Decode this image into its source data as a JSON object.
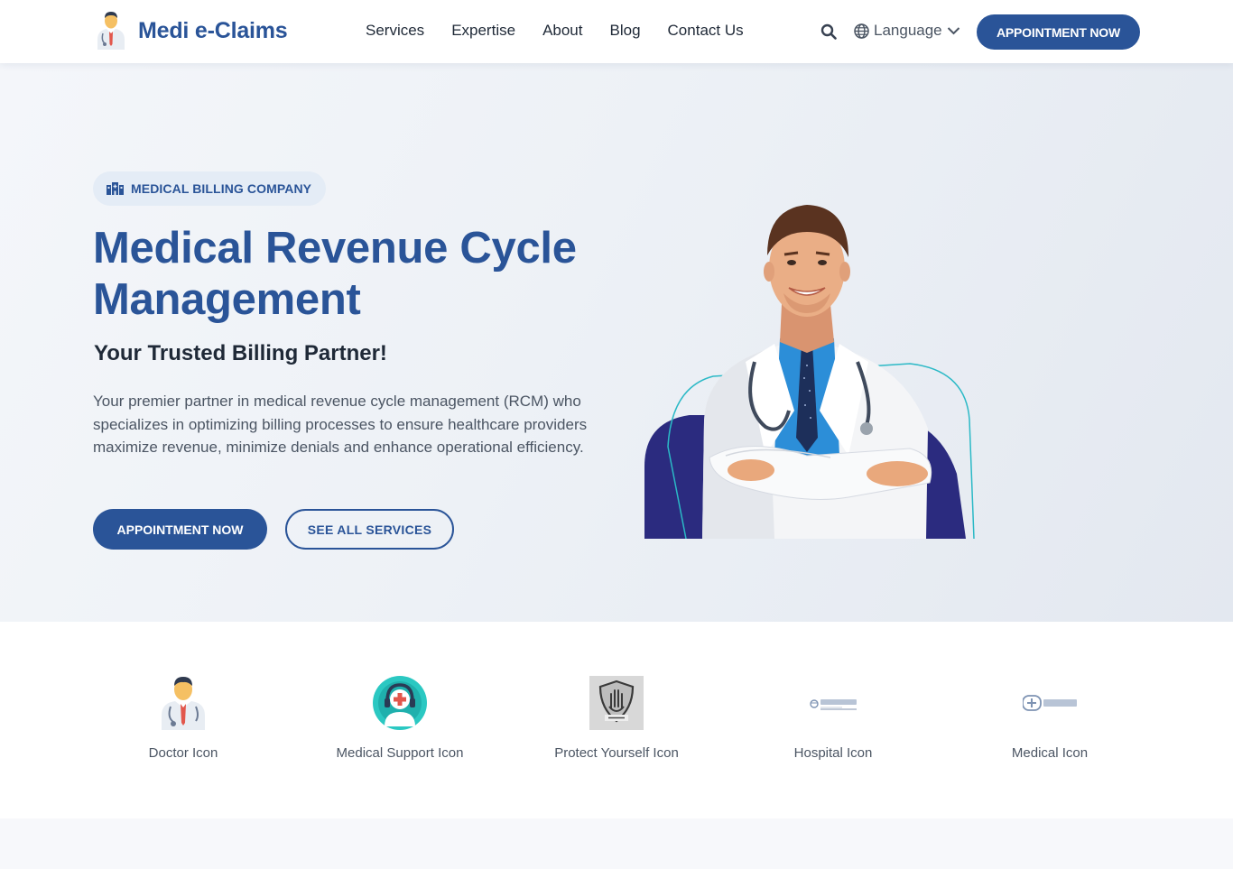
{
  "header": {
    "brand": "Medi e-Claims",
    "nav": [
      "Services",
      "Expertise",
      "About",
      "Blog",
      "Contact Us"
    ],
    "language_label": "Language",
    "cta_label": "APPOINTMENT NOW"
  },
  "hero": {
    "badge": "MEDICAL BILLING COMPANY",
    "title": "Medical Revenue Cycle Management",
    "subtitle": "Your Trusted Billing Partner!",
    "description": "Your premier partner in medical revenue cycle management (RCM) who specializes in optimizing billing processes to ensure healthcare providers maximize revenue, minimize denials and enhance operational efficiency.",
    "primary_cta": "APPOINTMENT NOW",
    "secondary_cta": "SEE ALL SERVICES"
  },
  "icons": [
    {
      "label": "Doctor Icon",
      "icon": "doctor-icon"
    },
    {
      "label": "Medical Support Icon",
      "icon": "medical-support-icon"
    },
    {
      "label": "Protect Yourself Icon",
      "icon": "protect-yourself-icon"
    },
    {
      "label": "Hospital Icon",
      "icon": "hospital-icon"
    },
    {
      "label": "Medical Icon",
      "icon": "medical-icon"
    }
  ],
  "colors": {
    "brand": "#2a5498",
    "navy": "#2b2b7f",
    "teal": "#2bb9c6"
  }
}
